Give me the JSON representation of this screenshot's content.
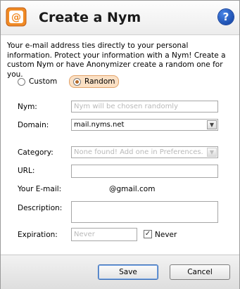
{
  "header": {
    "title": "Create a Nym",
    "help_icon": "?"
  },
  "intro": {
    "text": "Your e-mail address ties directly to your personal information. Protect your information with a Nym!  Create a custom Nym or have Anonymizer create a random one for you."
  },
  "mode": {
    "custom_label": "Custom",
    "random_label": "Random",
    "selected": "Random"
  },
  "form": {
    "nym_label": "Nym:",
    "nym_placeholder": "Nym will be chosen randomly",
    "domain_label": "Domain:",
    "domain_value": "mail.nyms.net",
    "category_label": "Category:",
    "category_placeholder": "None found! Add one in Preferences.",
    "url_label": "URL:",
    "url_value": "",
    "email_label": "Your E-mail:",
    "email_value": "@gmail.com",
    "description_label": "Description:",
    "description_value": "",
    "expiration_label": "Expiration:",
    "expiration_placeholder": "Never",
    "never_label": "Never",
    "never_checked": true
  },
  "footer": {
    "save_label": "Save",
    "cancel_label": "Cancel"
  }
}
